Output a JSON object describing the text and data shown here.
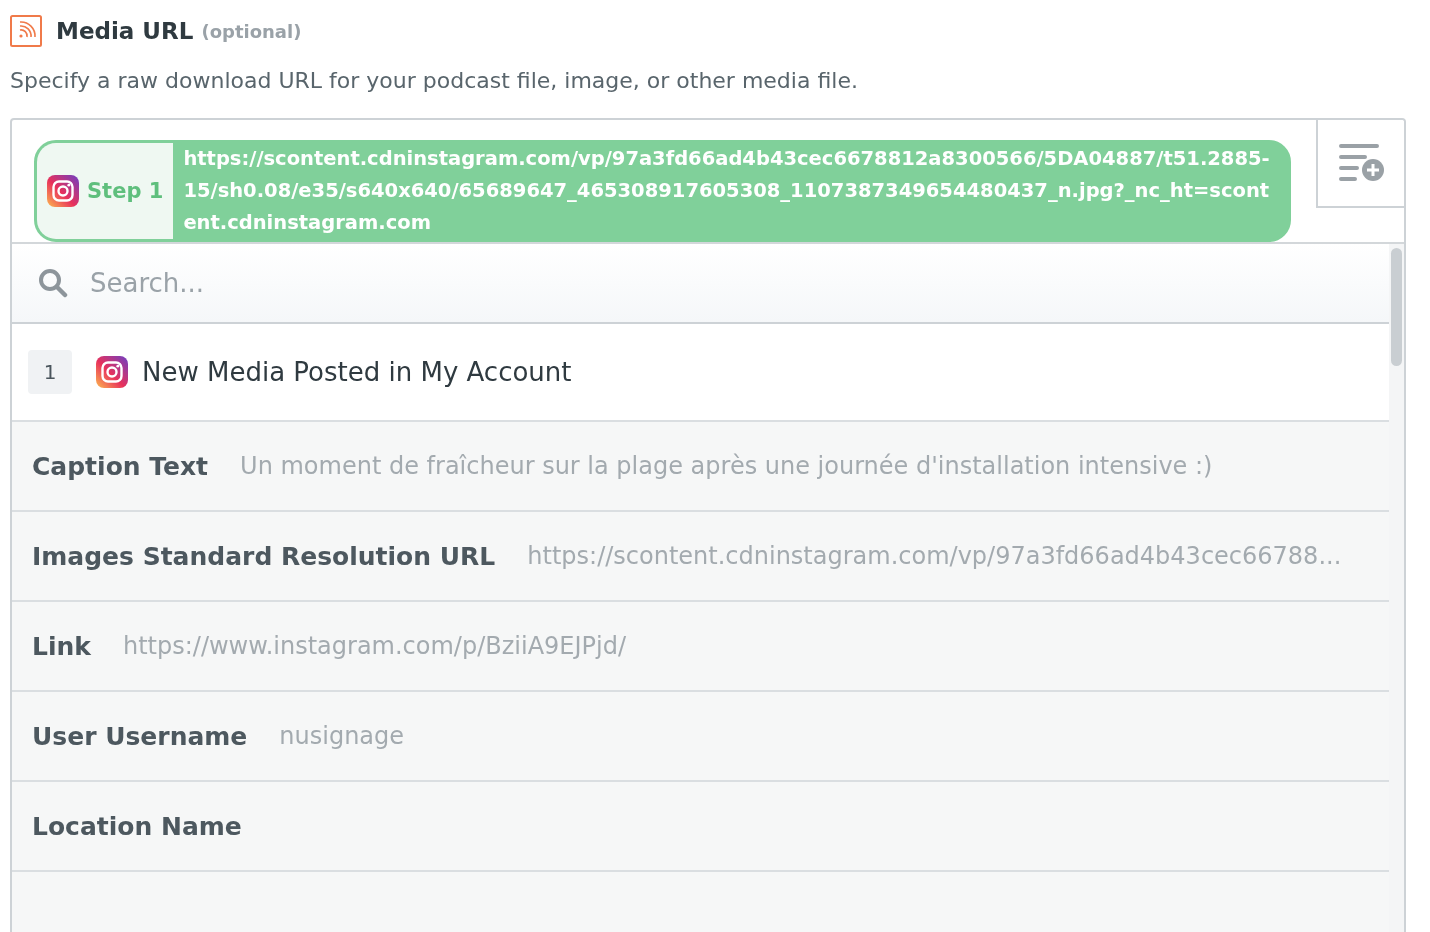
{
  "field": {
    "label": "Media URL",
    "hint": "(optional)",
    "description": "Specify a raw download URL for your podcast file, image, or other media file."
  },
  "token": {
    "step": "Step 1",
    "value": "https://scontent.cdninstagram.com/vp/97a3fd66ad4b43cec6678812a8300566/5DA04887/t51.2885-15/sh0.08/e35/s640x640/65689647_465308917605308_1107387349654480437_n.jpg?_nc_ht=scontent.cdninstagram.com"
  },
  "search": {
    "placeholder": "Search..."
  },
  "step": {
    "number": "1",
    "title": "New Media Posted in My Account"
  },
  "rows": [
    {
      "label": "Caption Text",
      "value": "Un moment de fraîcheur sur la plage après une journée d'installation intensive :)"
    },
    {
      "label": "Images Standard Resolution URL",
      "value": "https://scontent.cdninstagram.com/vp/97a3fd66ad4b43cec66788..."
    },
    {
      "label": "Link",
      "value": "https://www.instagram.com/p/BziiA9EJPjd/"
    },
    {
      "label": "User Username",
      "value": "nusignage"
    },
    {
      "label": "Location Name"
    }
  ]
}
